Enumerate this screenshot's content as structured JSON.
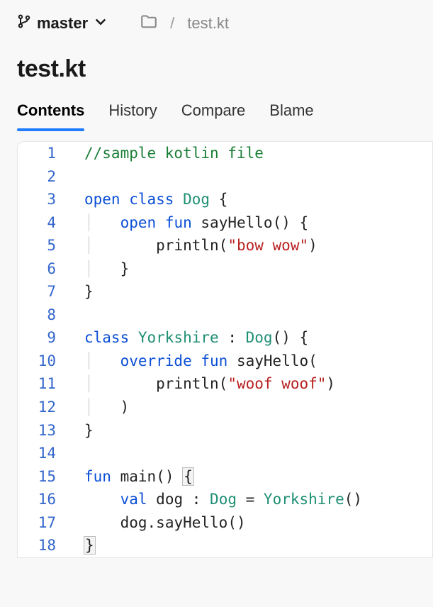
{
  "top": {
    "branch": "master",
    "breadcrumb": {
      "slash": "/",
      "file": "test.kt"
    }
  },
  "heading": "test.kt",
  "tabs": {
    "contents": "Contents",
    "history": "History",
    "compare": "Compare",
    "blame": "Blame"
  },
  "gutter": {
    "1": "1",
    "2": "2",
    "3": "3",
    "4": "4",
    "5": "5",
    "6": "6",
    "7": "7",
    "8": "8",
    "9": "9",
    "10": "10",
    "11": "11",
    "12": "12",
    "13": "13",
    "14": "14",
    "15": "15",
    "16": "16",
    "17": "17",
    "18": "18"
  },
  "code": {
    "l1_comment": "//sample kotlin file",
    "kw_open": "open",
    "kw_class": "class",
    "kw_fun": "fun",
    "kw_override": "override",
    "kw_val": "val",
    "ty_Dog": "Dog",
    "ty_Yorkshire": "Yorkshire",
    "id_sayHello": "sayHello",
    "id_println": "println",
    "id_main": "main",
    "id_dog": "dog",
    "str_bowwow": "\"bow wow\"",
    "str_woofwoof": "\"woof woof\"",
    "p_ob": "{",
    "p_cb": "}",
    "p_op": "(",
    "p_cp": ")",
    "p_opp": "()",
    "p_colon": " : ",
    "p_eq": " = ",
    "p_dot": ".",
    "sp1": " ",
    "ind1": "    ",
    "ind2": "        ",
    "guide1": "│   ",
    "guide2": "│       "
  }
}
